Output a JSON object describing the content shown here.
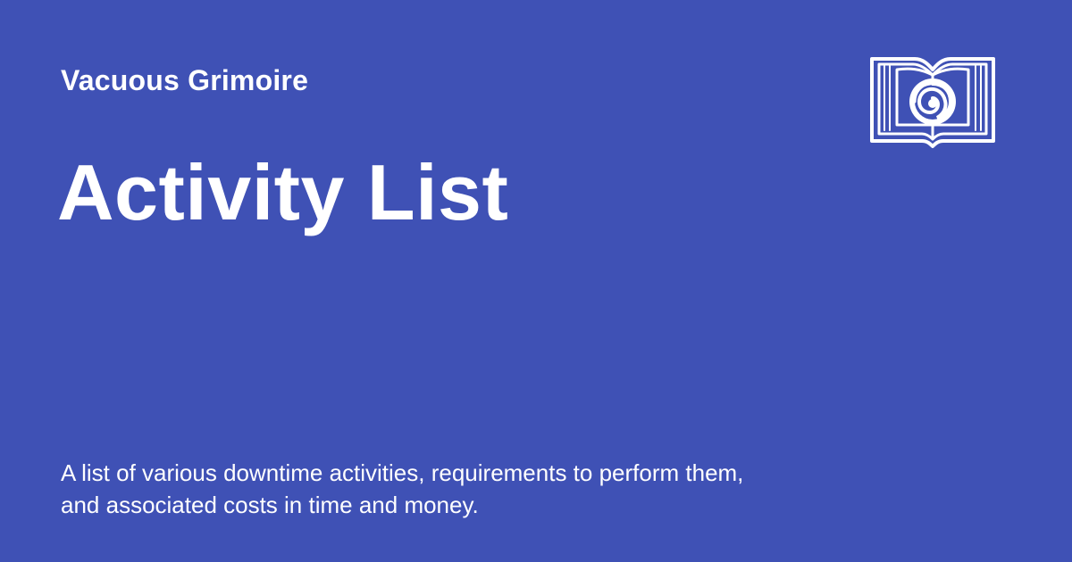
{
  "header": {
    "site_name": "Vacuous Grimoire",
    "logo_icon": "open-book-vortex-icon"
  },
  "main": {
    "title": "Activity List",
    "description": "A list of various downtime activities, requirements to perform them, and associated costs in time and money."
  },
  "colors": {
    "background": "#3f51b5",
    "text": "#ffffff"
  }
}
